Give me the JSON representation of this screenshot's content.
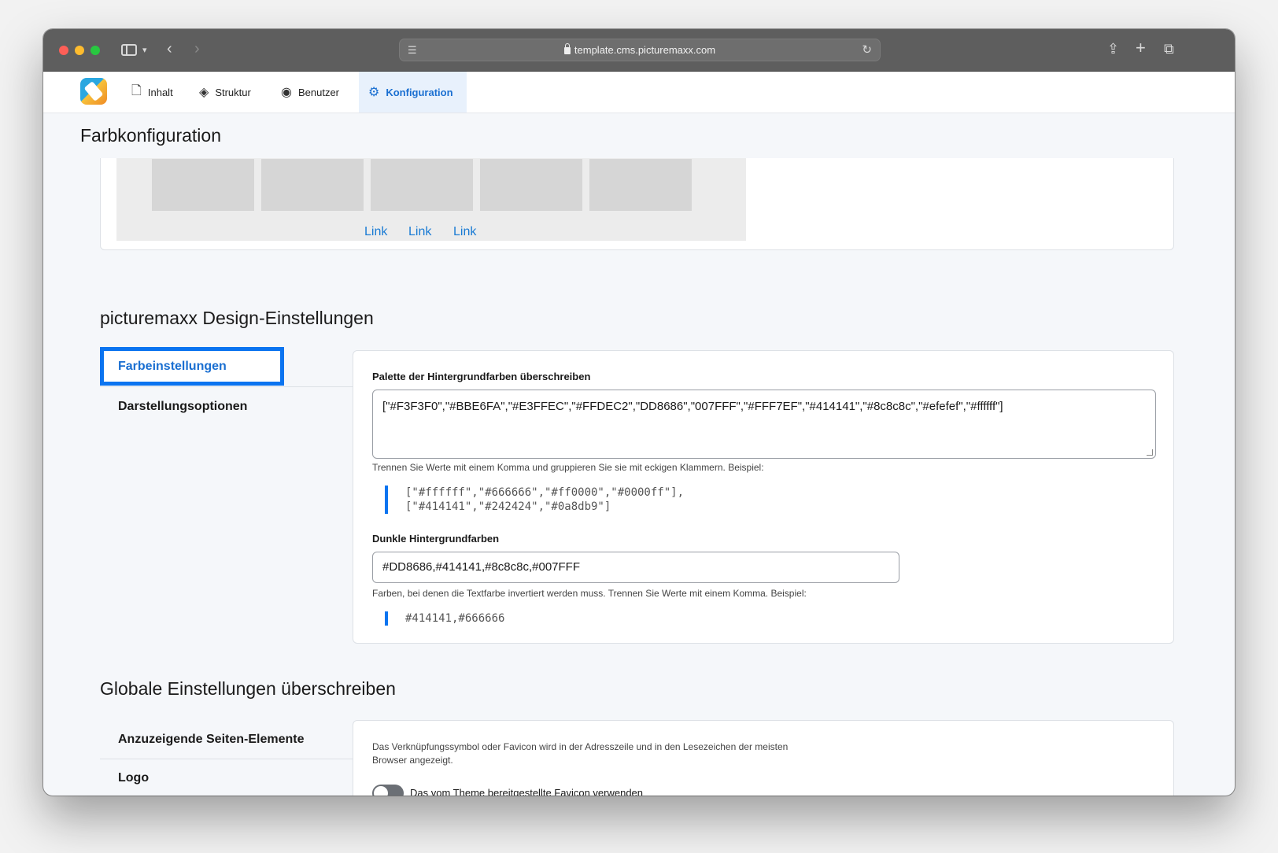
{
  "browser": {
    "url": "template.cms.picturemaxx.com"
  },
  "nav": {
    "items": [
      {
        "label": "Inhalt",
        "icon": "document-icon"
      },
      {
        "label": "Struktur",
        "icon": "layers-icon"
      },
      {
        "label": "Benutzer",
        "icon": "user-circle-icon"
      },
      {
        "label": "Konfiguration",
        "icon": "gear-icon"
      }
    ],
    "active": "Konfiguration"
  },
  "page": {
    "title": "Farbkonfiguration"
  },
  "preview": {
    "links": [
      "Link",
      "Link",
      "Link"
    ]
  },
  "design": {
    "title": "picturemaxx Design-Einstellungen",
    "tabs": [
      "Farbeinstellungen",
      "Darstellungsoptionen"
    ],
    "active_tab": "Farbeinstellungen",
    "palette_label": "Palette der Hintergrundfarben überschreiben",
    "palette_value": "[\"#F3F3F0\",\"#BBE6FA\",\"#E3FFEC\",\"#FFDEC2\",\"DD8686\",\"007FFF\",\"#FFF7EF\",\"#414141\",\"#8c8c8c\",\"#efefef\",\"#ffffff\"]",
    "palette_help": "Trennen Sie Werte mit einem Komma und gruppieren Sie sie mit eckigen Klammern. Beispiel:",
    "palette_example_line1": "[\"#ffffff\",\"#666666\",\"#ff0000\",\"#0000ff\"],",
    "palette_example_line2": "[\"#414141\",\"#242424\",\"#0a8db9\"]",
    "dark_label": "Dunkle Hintergrundfarben",
    "dark_value": "#DD8686,#414141,#8c8c8c,#007FFF",
    "dark_help": "Farben, bei denen die Textfarbe invertiert werden muss. Trennen Sie Werte mit einem Komma. Beispiel:",
    "dark_example": "#414141,#666666"
  },
  "global": {
    "title": "Globale Einstellungen überschreiben",
    "tabs": [
      "Anzuzeigende Seiten-Elemente",
      "Logo"
    ],
    "favicon_help_line1": "Das Verknüpfungssymbol oder Favicon wird in der Adresszeile und in den Lesezeichen der meisten",
    "favicon_help_line2": "Browser angezeigt.",
    "favicon_toggle_label": "Das vom Theme bereitgestellte Favicon verwenden"
  },
  "colors": {
    "accent": "#0b74f0",
    "link": "#1a7bd4",
    "active_nav_bg": "#e8f1fc"
  }
}
